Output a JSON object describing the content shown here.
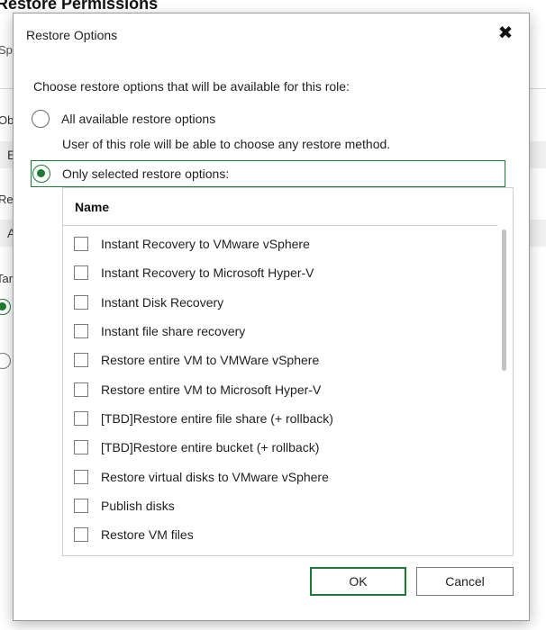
{
  "background": {
    "title": "Restore Permissions",
    "subtitle": "Sp",
    "label1": "Ob",
    "field1": "E",
    "label2": "Re",
    "field2": "A",
    "label3": "Tar"
  },
  "dialog": {
    "title": "Restore Options",
    "close_glyph": "✖",
    "prompt": "Choose restore options that will be available for this role:",
    "option_all": "All available restore options",
    "option_all_hint": "User of this role will be able to choose any restore method.",
    "option_selected": "Only selected restore options:",
    "selected_option": "Only selected restore options:",
    "accent_color": "#1e7b34"
  },
  "list": {
    "column_header": "Name",
    "items": [
      {
        "label": "Instant Recovery to VMware vSphere",
        "checked": false
      },
      {
        "label": "Instant Recovery to Microsoft Hyper-V",
        "checked": false
      },
      {
        "label": "Instant Disk Recovery",
        "checked": false
      },
      {
        "label": "Instant file share recovery",
        "checked": false
      },
      {
        "label": "Restore entire VM to VMWare vSphere",
        "checked": false
      },
      {
        "label": "Restore entire VM to Microsoft Hyper-V",
        "checked": false
      },
      {
        "label": "[TBD]Restore entire file share (+ rollback)",
        "checked": false
      },
      {
        "label": "[TBD]Restore entire bucket (+ rollback)",
        "checked": false
      },
      {
        "label": "Restore virtual disks to VMware vSphere",
        "checked": false
      },
      {
        "label": "Publish disks",
        "checked": false
      },
      {
        "label": "Restore VM files",
        "checked": false
      },
      {
        "label": "",
        "checked": false
      }
    ]
  },
  "buttons": {
    "ok": "OK",
    "cancel": "Cancel"
  }
}
